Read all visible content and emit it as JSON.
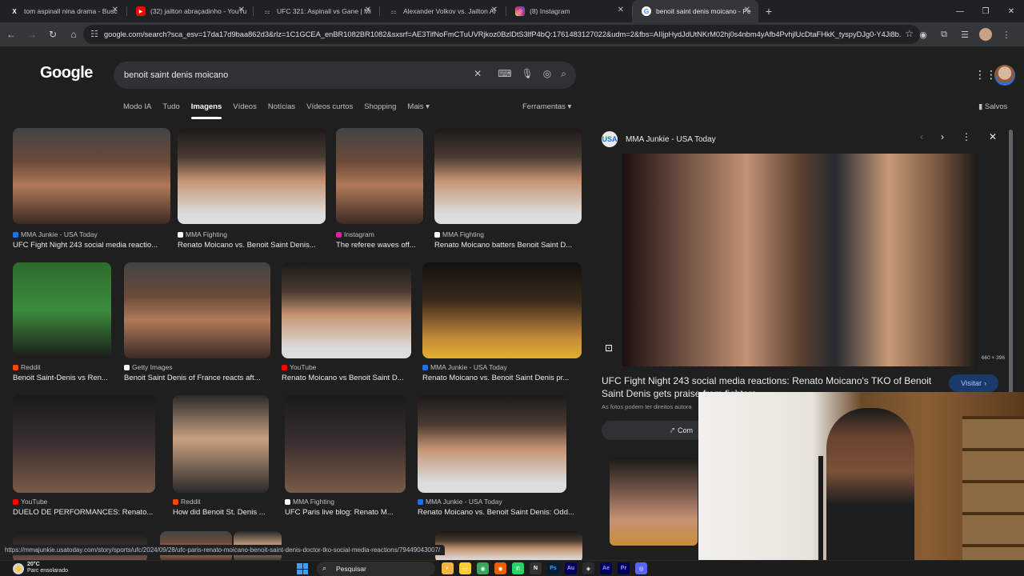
{
  "tabs": [
    {
      "title": "tom aspinall nina drama - Busc",
      "icon": "x-icon",
      "color": "#ffffff",
      "glyph": "X"
    },
    {
      "title": "(32) jailton abraçadinho - YouTu",
      "icon": "youtube-icon",
      "color": "#ff0000",
      "glyph": "▶"
    },
    {
      "title": "UFC 321: Aspinall vs Gane | Mi",
      "icon": "ufc-icon",
      "color": "#9e9e9e",
      "glyph": "U"
    },
    {
      "title": "Alexander Volkov vs. Jailton Al",
      "icon": "ufc-icon",
      "color": "#9e9e9e",
      "glyph": "U"
    },
    {
      "title": "(8) Instagram",
      "icon": "instagram-icon",
      "color": "#d6249f",
      "glyph": "◎"
    },
    {
      "title": "benoit saint denis moicano - Pe",
      "icon": "google-icon",
      "color": "#4285f4",
      "glyph": "G"
    }
  ],
  "address_bar": {
    "url": "google.com/search?sca_esv=17da17d9baa862d3&rlz=1C1GCEA_enBR1082BR1082&sxsrf=AE3TifNoFmCTuUVRjkoz0BzlDtS3lfP4bQ:1761483127022&udm=2&fbs=AIIjpHydJdUtNKrM02hj0s4nbm4yAfb4PvhjlUcDtaFHkK_tyspyDJg0-Y4Ji8b..."
  },
  "search": {
    "logo": "Google",
    "query": "benoit saint denis moicano"
  },
  "modes": [
    "Modo IA",
    "Tudo",
    "Imagens",
    "Vídeos",
    "Notícias",
    "Vídeos curtos",
    "Shopping",
    "Mais ▾"
  ],
  "active_mode": "Imagens",
  "tools_label": "Ferramentas ▾",
  "saved_label": "Salvos",
  "results": [
    {
      "source": "MMA Junkie - USA Today",
      "caption": "UFC Fight Night 243 social media reactio...",
      "src_color": "#1a73e8"
    },
    {
      "source": "MMA Fighting",
      "caption": "Renato Moicano vs. Benoit Saint Denis...",
      "src_color": "#ffffff"
    },
    {
      "source": "Instagram",
      "caption": "The referee waves off...",
      "src_color": "#d6249f"
    },
    {
      "source": "MMA Fighting",
      "caption": "Renato Moicano batters Benoit Saint D...",
      "src_color": "#ffffff"
    },
    {
      "source": "Reddit",
      "caption": "Benoit Saint-Denis vs Ren...",
      "src_color": "#ff4500"
    },
    {
      "source": "Getty Images",
      "caption": "Benoit Saint Denis of France reacts aft...",
      "src_color": "#ffffff"
    },
    {
      "source": "YouTube",
      "caption": "Renato Moicano vs Benoit Saint D...",
      "src_color": "#ff0000"
    },
    {
      "source": "MMA Junkie - USA Today",
      "caption": "Renato Moicano vs. Benoit Saint Denis pr...",
      "src_color": "#1a73e8"
    },
    {
      "source": "YouTube",
      "caption": "DUELO DE PERFORMANCES: Renato...",
      "src_color": "#ff0000"
    },
    {
      "source": "Reddit",
      "caption": "How did Benoit St. Denis ...",
      "src_color": "#ff4500"
    },
    {
      "source": "MMA Fighting",
      "caption": "UFC Paris live blog: Renato M...",
      "src_color": "#ffffff"
    },
    {
      "source": "MMA Junkie - USA Today",
      "caption": "Renato Moicano vs. Benoit Saint Denis: Odd...",
      "src_color": "#1a73e8"
    }
  ],
  "viewer": {
    "source": "MMA Junkie - USA Today",
    "source_logo": "USA",
    "dimensions": "660 × 396",
    "title": "UFC Fight Night 243 social media reactions: Renato Moicano's TKO of Benoit Saint Denis gets praise from fighters",
    "visit_label": "Visitar ›",
    "rights_note": "As fotos podem ter direitos autora",
    "share_label": "Com"
  },
  "status_url": "https://mmajunkie.usatoday.com/story/sports/ufc/2024/09/28/ufc-paris-renato-moicano-benoit-saint-denis-doctor-tko-social-media-reactions/79449043007/",
  "taskbar": {
    "temperature": "20°C",
    "weather": "Parc ensolarado",
    "search_label": "Pesquisar"
  }
}
